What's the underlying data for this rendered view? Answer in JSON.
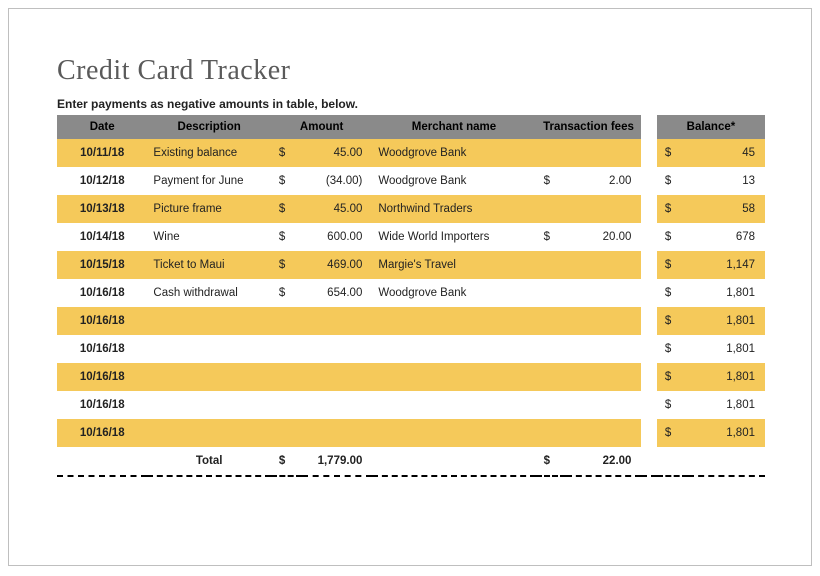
{
  "title": "Credit Card Tracker",
  "instruction": "Enter payments as negative amounts in table, below.",
  "headers": {
    "date": "Date",
    "description": "Description",
    "amount": "Amount",
    "merchant": "Merchant name",
    "fees": "Transaction fees",
    "balance": "Balance*"
  },
  "rows": [
    {
      "date": "10/11/18",
      "description": "Existing balance",
      "amt_s": "$",
      "amt_v": "45.00",
      "merchant": "Woodgrove Bank",
      "fee_s": "",
      "fee_v": "",
      "bal_s": "$",
      "bal_v": "45"
    },
    {
      "date": "10/12/18",
      "description": "Payment for June",
      "amt_s": "$",
      "amt_v": "(34.00)",
      "merchant": "Woodgrove Bank",
      "fee_s": "$",
      "fee_v": "2.00",
      "bal_s": "$",
      "bal_v": "13"
    },
    {
      "date": "10/13/18",
      "description": "Picture frame",
      "amt_s": "$",
      "amt_v": "45.00",
      "merchant": "Northwind Traders",
      "fee_s": "",
      "fee_v": "",
      "bal_s": "$",
      "bal_v": "58"
    },
    {
      "date": "10/14/18",
      "description": "Wine",
      "amt_s": "$",
      "amt_v": "600.00",
      "merchant": "Wide World Importers",
      "fee_s": "$",
      "fee_v": "20.00",
      "bal_s": "$",
      "bal_v": "678"
    },
    {
      "date": "10/15/18",
      "description": "Ticket to Maui",
      "amt_s": "$",
      "amt_v": "469.00",
      "merchant": "Margie's Travel",
      "fee_s": "",
      "fee_v": "",
      "bal_s": "$",
      "bal_v": "1,147"
    },
    {
      "date": "10/16/18",
      "description": "Cash withdrawal",
      "amt_s": "$",
      "amt_v": "654.00",
      "merchant": "Woodgrove Bank",
      "fee_s": "",
      "fee_v": "",
      "bal_s": "$",
      "bal_v": "1,801"
    },
    {
      "date": "10/16/18",
      "description": "",
      "amt_s": "",
      "amt_v": "",
      "merchant": "",
      "fee_s": "",
      "fee_v": "",
      "bal_s": "$",
      "bal_v": "1,801"
    },
    {
      "date": "10/16/18",
      "description": "",
      "amt_s": "",
      "amt_v": "",
      "merchant": "",
      "fee_s": "",
      "fee_v": "",
      "bal_s": "$",
      "bal_v": "1,801"
    },
    {
      "date": "10/16/18",
      "description": "",
      "amt_s": "",
      "amt_v": "",
      "merchant": "",
      "fee_s": "",
      "fee_v": "",
      "bal_s": "$",
      "bal_v": "1,801"
    },
    {
      "date": "10/16/18",
      "description": "",
      "amt_s": "",
      "amt_v": "",
      "merchant": "",
      "fee_s": "",
      "fee_v": "",
      "bal_s": "$",
      "bal_v": "1,801"
    },
    {
      "date": "10/16/18",
      "description": "",
      "amt_s": "",
      "amt_v": "",
      "merchant": "",
      "fee_s": "",
      "fee_v": "",
      "bal_s": "$",
      "bal_v": "1,801"
    }
  ],
  "totals": {
    "label": "Total",
    "amt_s": "$",
    "amt_v": "1,779.00",
    "fee_s": "$",
    "fee_v": "22.00"
  },
  "stripes": [
    "odd",
    "even",
    "odd",
    "even",
    "odd",
    "even",
    "odd",
    "even",
    "odd",
    "even",
    "odd"
  ]
}
